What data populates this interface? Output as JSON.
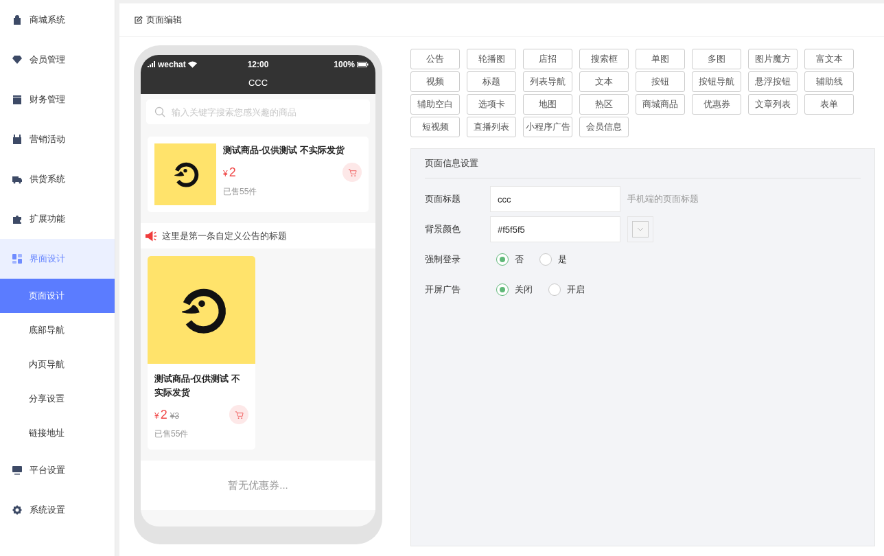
{
  "sidebar": {
    "items": [
      {
        "label": "商城系统",
        "selected": false
      },
      {
        "label": "会员管理",
        "selected": false
      },
      {
        "label": "财务管理",
        "selected": false
      },
      {
        "label": "营销活动",
        "selected": false
      },
      {
        "label": "供货系统",
        "selected": false
      },
      {
        "label": "扩展功能",
        "selected": false
      },
      {
        "label": "界面设计",
        "selected": true,
        "children": [
          {
            "label": "页面设计",
            "selected": true
          },
          {
            "label": "底部导航",
            "selected": false
          },
          {
            "label": "内页导航",
            "selected": false
          },
          {
            "label": "分享设置",
            "selected": false
          },
          {
            "label": "链接地址",
            "selected": false
          }
        ]
      },
      {
        "label": "平台设置",
        "selected": false
      },
      {
        "label": "系统设置",
        "selected": false
      }
    ]
  },
  "header": {
    "title": "页面编辑"
  },
  "phone": {
    "status": {
      "carrier": "wechat",
      "time": "12:00",
      "battery": "100%"
    },
    "title": "CCC",
    "search": {
      "placeholder": "输入关键字搜索您感兴趣的商品"
    },
    "list_product": {
      "name": "测试商品-仅供测试 不实际发货",
      "currency": "¥",
      "price": "2",
      "sold": "已售55件"
    },
    "notice": "这里是第一条自定义公告的标题",
    "grid_product": {
      "name": "测试商品-仅供测试 不实际发货",
      "currency": "¥",
      "price": "2",
      "original_price": "¥3",
      "sold": "已售55件"
    },
    "coupon_empty": "暂无优惠券..."
  },
  "components": [
    "公告",
    "轮播图",
    "店招",
    "搜索框",
    "单图",
    "多图",
    "图片魔方",
    "富文本",
    "视频",
    "标题",
    "列表导航",
    "文本",
    "按钮",
    "按钮导航",
    "悬浮按钮",
    "辅助线",
    "辅助空白",
    "选项卡",
    "地图",
    "热区",
    "商城商品",
    "优惠券",
    "文章列表",
    "表单",
    "短视频",
    "直播列表",
    "小程序广告",
    "会员信息"
  ],
  "settings": {
    "title": "页面信息设置",
    "fields": [
      {
        "kind": "text",
        "label": "页面标题",
        "value": "ccc",
        "hint": "手机端的页面标题"
      },
      {
        "kind": "color",
        "label": "背景颜色",
        "value": "#f5f5f5"
      },
      {
        "kind": "radio",
        "label": "强制登录",
        "options": [
          {
            "label": "否",
            "selected": true
          },
          {
            "label": "是",
            "selected": false
          }
        ]
      },
      {
        "kind": "radio",
        "label": "开屏广告",
        "options": [
          {
            "label": "关闭",
            "selected": true
          },
          {
            "label": "开启",
            "selected": false
          }
        ]
      }
    ]
  }
}
